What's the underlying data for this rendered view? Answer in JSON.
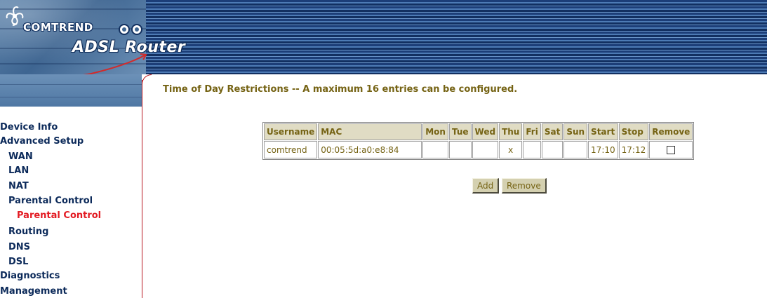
{
  "header": {
    "brand": "COMTREND",
    "product": "ADSL Router"
  },
  "sidebar": {
    "items": [
      {
        "label": "Device Info"
      },
      {
        "label": "Advanced Setup"
      },
      {
        "label": "WAN"
      },
      {
        "label": "LAN"
      },
      {
        "label": "NAT"
      },
      {
        "label": "Parental Control"
      },
      {
        "label": "Parental Control",
        "active": true
      },
      {
        "label": "Routing"
      },
      {
        "label": "DNS"
      },
      {
        "label": "DSL"
      },
      {
        "label": "Diagnostics"
      },
      {
        "label": "Management"
      }
    ]
  },
  "main": {
    "title": "Time of Day Restrictions -- A maximum 16 entries can be configured.",
    "table": {
      "headers": [
        "Username",
        "MAC",
        "Mon",
        "Tue",
        "Wed",
        "Thu",
        "Fri",
        "Sat",
        "Sun",
        "Start",
        "Stop",
        "Remove"
      ],
      "rows": [
        {
          "username": "comtrend",
          "mac": "00:05:5d:a0:e8:84",
          "mon": "",
          "tue": "",
          "wed": "",
          "thu": "x",
          "fri": "",
          "sat": "",
          "sun": "",
          "start": "17:10",
          "stop": "17:12",
          "remove_checked": false
        }
      ]
    },
    "buttons": {
      "add": "Add",
      "remove": "Remove"
    }
  },
  "colors": {
    "nav_text": "#0c2a5a",
    "nav_active": "#e31b23",
    "content_text": "#756314",
    "table_header_bg": "#e0dcc4",
    "divider": "#b8161e"
  }
}
